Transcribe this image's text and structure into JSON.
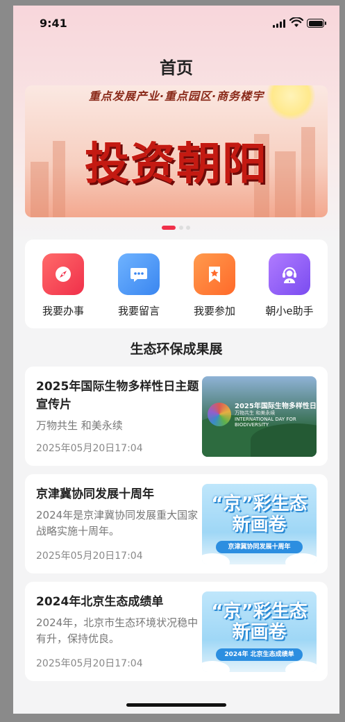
{
  "status_bar": {
    "time": "9:41"
  },
  "page": {
    "title": "首页"
  },
  "banner": {
    "subtitle": "重点发展产业·重点园区·商务楼宇",
    "headline": "投资朝阳",
    "active_index": 0,
    "count": 3
  },
  "services": [
    {
      "label": "我要办事",
      "icon": "compass-icon",
      "color_from": "#ff6a6a",
      "color_to": "#f0304a"
    },
    {
      "label": "我要留言",
      "icon": "chat-bubble-icon",
      "color_from": "#6fb3ff",
      "color_to": "#3a86f0"
    },
    {
      "label": "我要参加",
      "icon": "bookmark-star-icon",
      "color_from": "#ff9a4d",
      "color_to": "#ff6a2a"
    },
    {
      "label": "朝小e助手",
      "icon": "assistant-icon",
      "color_from": "#b07bff",
      "color_to": "#7a4cf0"
    }
  ],
  "section": {
    "title": "生态环保成果展"
  },
  "articles": [
    {
      "title": "2025年国际生物多样性日主题宣传片",
      "desc": "万物共生 和美永续",
      "date": "2025年05月20日17:04",
      "thumb": {
        "line1": "2025年国际生物多样性日",
        "line2": "万物共生 和美永续",
        "line3": "INTERNATIONAL DAY FOR BIODIVERSITY"
      }
    },
    {
      "title": "京津冀协同发展十周年",
      "desc": "2024年是京津冀协同发展重大国家战略实施十周年。",
      "date": "2025年05月20日17:04",
      "thumb": {
        "line1": "“京”彩生态",
        "line2": "新画卷",
        "ribbon": "京津冀协同发展十周年"
      }
    },
    {
      "title": "2024年北京生态成绩单",
      "desc": "2024年，北京市生态环境状况稳中有升，保持优良。",
      "date": "2025年05月20日17:04",
      "thumb": {
        "line1": "“京”彩生态",
        "line2": "新画卷",
        "ribbon": "2024年 北京生态成绩单"
      }
    }
  ],
  "colors": {
    "accent": "#f0304a",
    "text": "#222222",
    "muted": "#777777"
  }
}
